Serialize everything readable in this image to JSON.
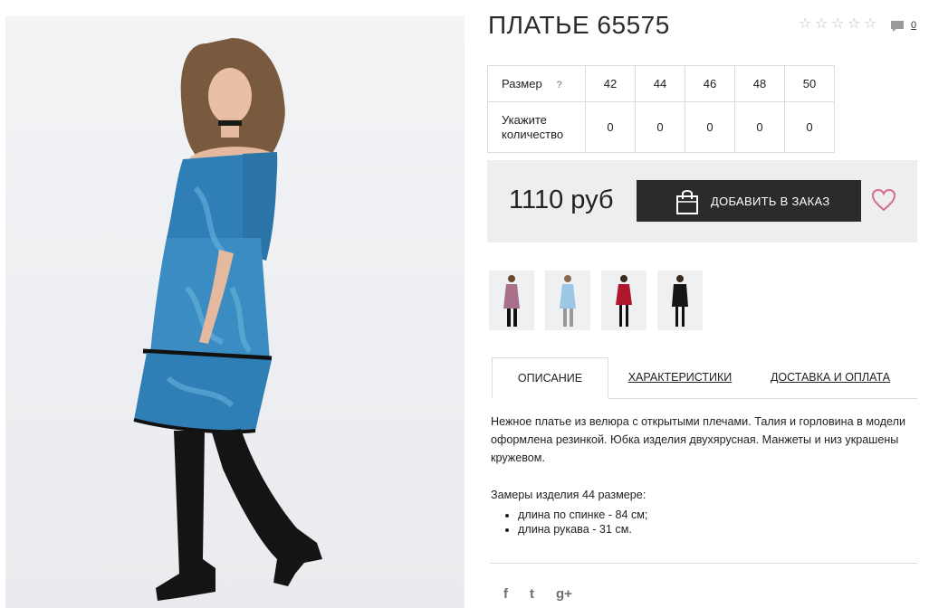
{
  "product": {
    "title": "ПЛАТЬЕ 65575",
    "comment_count": "0",
    "rating_stars": 0
  },
  "sizes": {
    "header_label": "Размер",
    "help": "?",
    "values": [
      "42",
      "44",
      "46",
      "48",
      "50"
    ],
    "qty_label_line1": "Укажите",
    "qty_label_line2": "количество",
    "quantities": [
      "0",
      "0",
      "0",
      "0",
      "0"
    ]
  },
  "purchase": {
    "price": "1110 руб",
    "order_button": "ДОБАВИТЬ В ЗАКАЗ"
  },
  "tabs": {
    "description": "ОПИСАНИЕ",
    "characteristics": "ХАРАКТЕРИСТИКИ",
    "delivery": "ДОСТАВКА И ОПЛАТА"
  },
  "description": {
    "text": "Нежное платье из велюра с открытыми плечами. Талия и горловина в модели оформлена резинкой. Юбка изделия двухярусная. Манжеты и низ украшены кружевом.",
    "measure_title": "Замеры изделия 44 размере:",
    "measures": [
      "длина по спинке - 84 см;",
      "длина рукава - 31 см."
    ]
  },
  "thumbnails": [
    {
      "dress_color": "#a8708a"
    },
    {
      "dress_color": "#9cc8e6"
    },
    {
      "dress_color": "#b0162c"
    },
    {
      "dress_color": "#161616"
    }
  ],
  "social": {
    "facebook": "f",
    "twitter": "t",
    "google": "g+"
  },
  "colors": {
    "button": "#2b2b2b",
    "heart": "#d96b8a",
    "price_band": "#eeeeee",
    "main_dress": "#2f7fb6"
  }
}
